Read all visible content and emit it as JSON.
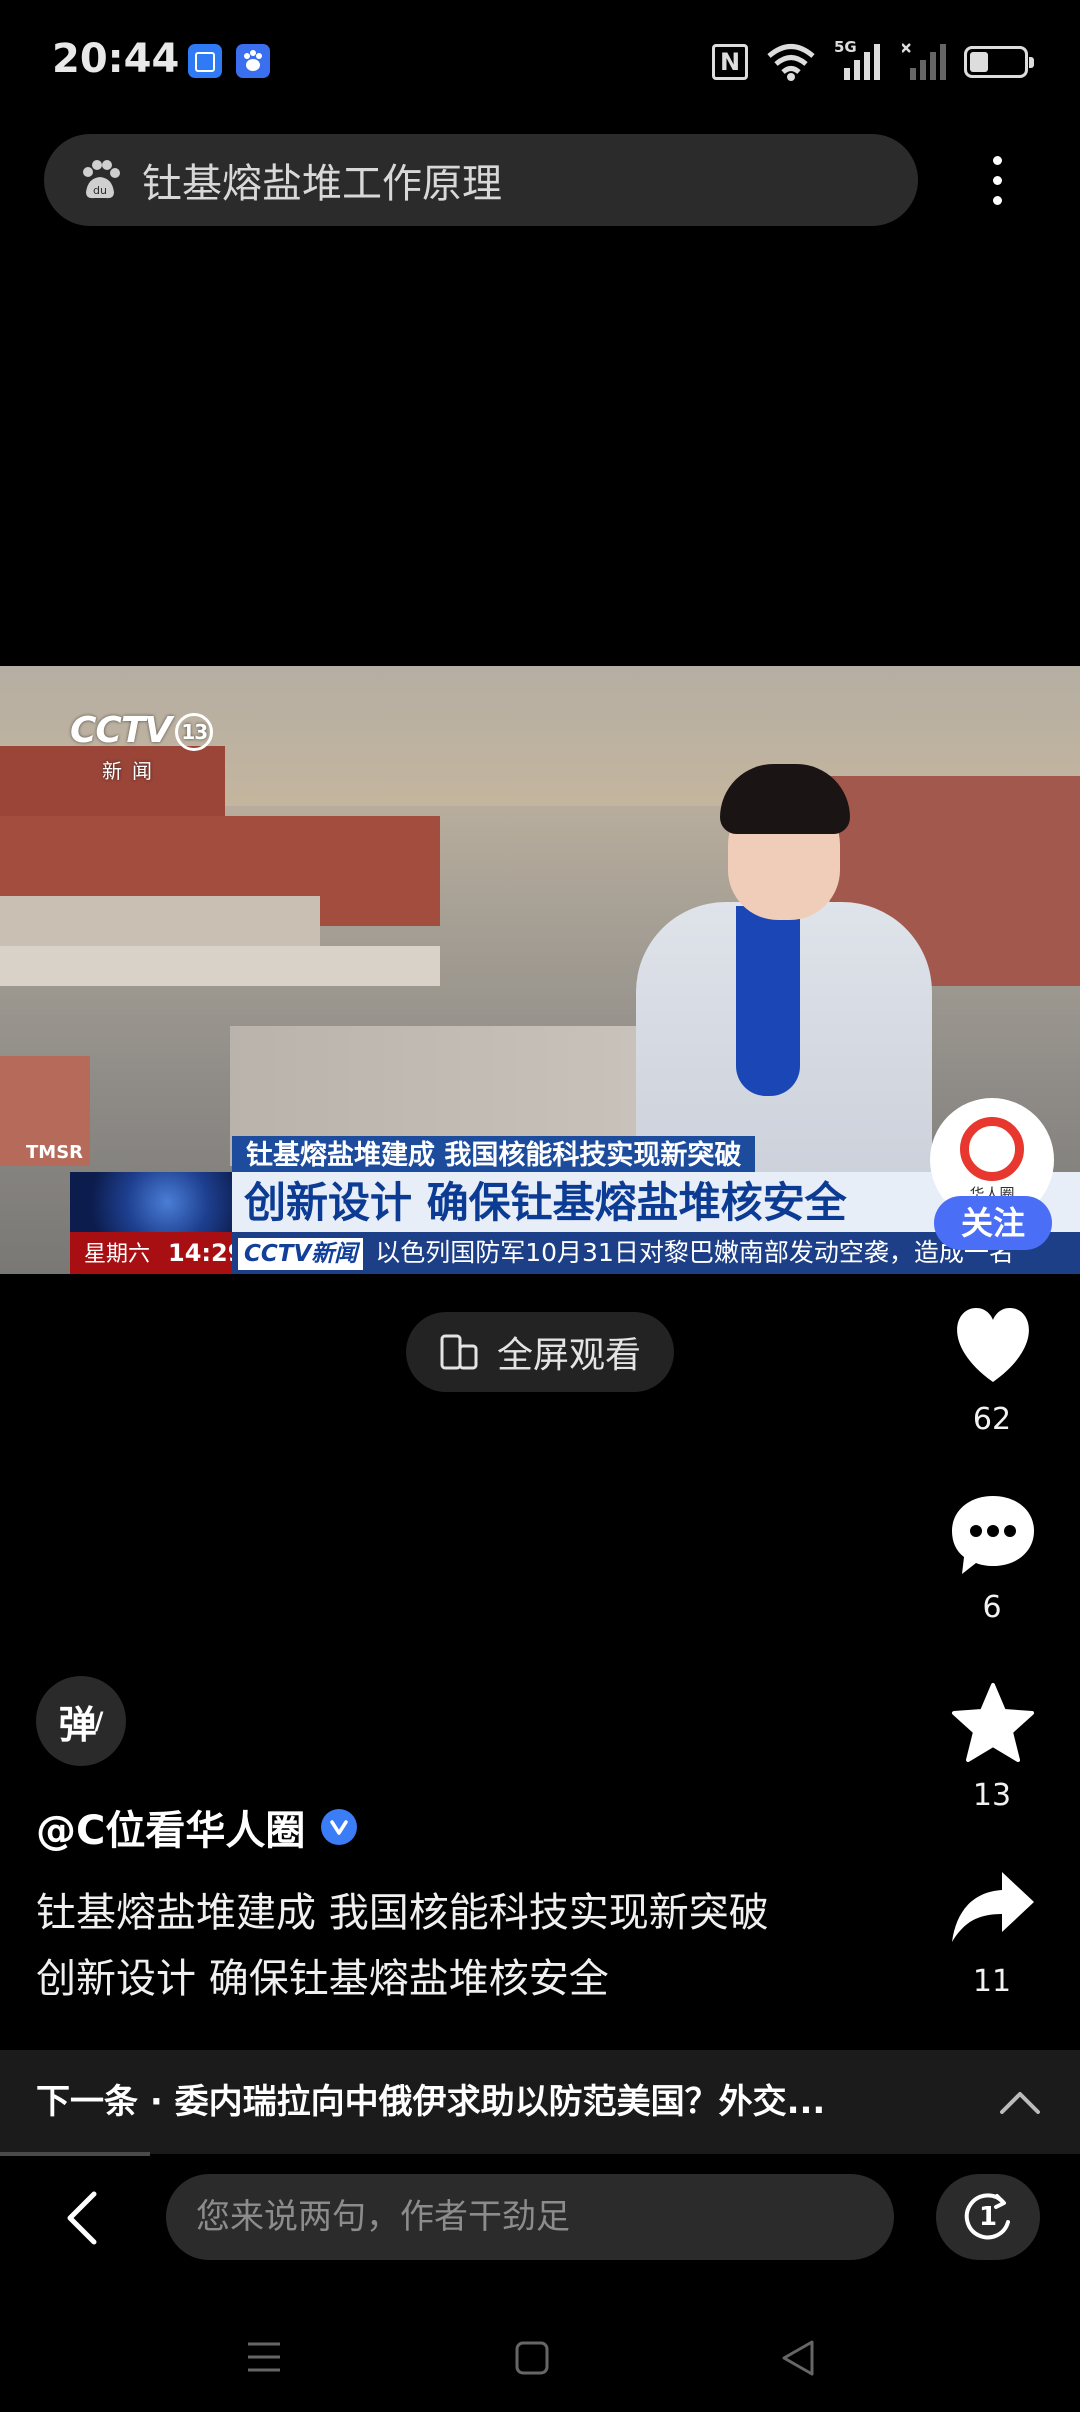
{
  "status_bar": {
    "time": "20:44",
    "network": "5G",
    "battery_level": 0.35,
    "icons": [
      "app-badge-blue-icon",
      "baidu-app-badge-icon",
      "nfc-icon",
      "wifi-icon",
      "signal-5g-icon",
      "signal-no-service-icon",
      "battery-icon"
    ]
  },
  "search": {
    "query": "钍基熔盐堆工作原理",
    "icon": "baidu-paw-icon"
  },
  "video": {
    "channel_logo": "CCTV",
    "channel_number": "13",
    "channel_sub": "新闻",
    "ticker_top": "钍基熔盐堆建成 我国核能科技实现新突破",
    "ticker_main": "创新设计 确保钍基熔盐堆核安全",
    "ticker_day": "星期六",
    "ticker_time": "14:29",
    "ticker_logo": "CCTV新闻",
    "ticker_bottom": "以色列国防军10月31日对黎巴嫩南部发动空袭，造成一名",
    "sign_text": "TMSR"
  },
  "author_badge": {
    "avatar_label": "华人圈",
    "follow_label": "关注"
  },
  "fullscreen": {
    "label": "全屏观看"
  },
  "actions": {
    "like_count": "62",
    "comment_count": "6",
    "favorite_count": "13",
    "share_count": "11"
  },
  "danmaku": {
    "label": "弹"
  },
  "post": {
    "author": "@C位看华人圈",
    "caption_line1": "钍基熔盐堆建成 我国核能科技实现新突破",
    "caption_line2": "创新设计 确保钍基熔盐堆核安全"
  },
  "next": {
    "text": "下一条 · 委内瑞拉向中俄伊求助以防范美国？外交..."
  },
  "comment_bar": {
    "placeholder": "您来说两句，作者干劲足",
    "tab_count": "1"
  },
  "colors": {
    "accent_blue": "#4a6ef5",
    "cctv_blue": "#1c3f87",
    "brand_red": "#e8372f"
  }
}
